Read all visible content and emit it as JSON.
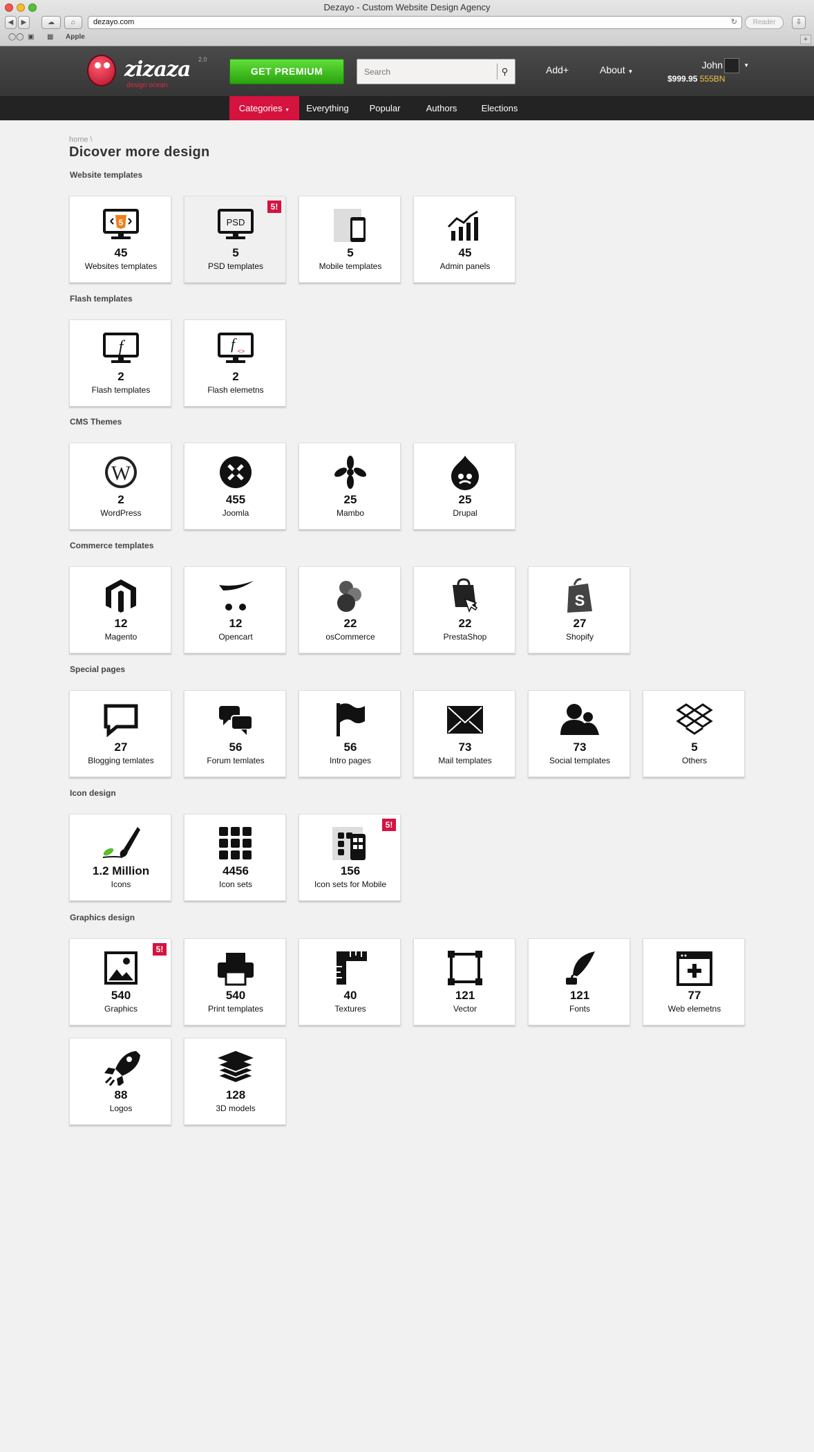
{
  "browser": {
    "title": "Dezayo - Custom Website Design Agency",
    "url": "dezayo.com",
    "reader": "Reader",
    "bookmark": "Apple"
  },
  "header": {
    "logo_word": "zizaza",
    "logo_version": "2.0",
    "logo_tagline": "design ocean",
    "premium": "GET PREMIUM",
    "search_placeholder": "Search",
    "add": "Add+",
    "about": "About",
    "user_name": "John",
    "balance": "$999.95",
    "credits": "555BN"
  },
  "subnav": [
    "Categories",
    "Everything",
    "Popular",
    "Authors",
    "Elections"
  ],
  "breadcrumb": "home \\",
  "page_title": "Dicover more design",
  "badge_text": "5!",
  "sections": [
    {
      "title": "Website templates",
      "tiles": [
        {
          "count": "45",
          "label": "Websites templates",
          "icon": "html5-monitor-icon"
        },
        {
          "count": "5",
          "label": "PSD templates",
          "icon": "psd-monitor-icon"
        },
        {
          "count": "5",
          "label": "Mobile templates",
          "icon": "mobile-icon"
        },
        {
          "count": "45",
          "label": "Admin panels",
          "icon": "chart-icon"
        }
      ]
    },
    {
      "title": "Flash templates",
      "tiles": [
        {
          "count": "2",
          "label": "Flash templates",
          "icon": "flash-monitor-icon"
        },
        {
          "count": "2",
          "label": "Flash elemetns",
          "icon": "flash-code-icon"
        }
      ]
    },
    {
      "title": "CMS Themes",
      "tiles": [
        {
          "count": "2",
          "label": "WordPress",
          "icon": "wordpress-icon"
        },
        {
          "count": "455",
          "label": "Joomla",
          "icon": "joomla-icon"
        },
        {
          "count": "25",
          "label": "Mambo",
          "icon": "mambo-icon"
        },
        {
          "count": "25",
          "label": "Drupal",
          "icon": "drupal-icon"
        }
      ]
    },
    {
      "title": "Commerce templates",
      "tiles": [
        {
          "count": "12",
          "label": "Magento",
          "icon": "magento-icon"
        },
        {
          "count": "12",
          "label": "Opencart",
          "icon": "opencart-icon"
        },
        {
          "count": "22",
          "label": "osCommerce",
          "icon": "oscommerce-icon"
        },
        {
          "count": "22",
          "label": "PrestaShop",
          "icon": "prestashop-icon"
        },
        {
          "count": "27",
          "label": "Shopify",
          "icon": "shopify-icon"
        }
      ]
    },
    {
      "title": "Special pages",
      "tiles": [
        {
          "count": "27",
          "label": "Blogging temlates",
          "icon": "speech-bubble-icon"
        },
        {
          "count": "56",
          "label": "Forum temlates",
          "icon": "chat-bubbles-icon"
        },
        {
          "count": "56",
          "label": "Intro pages",
          "icon": "flag-icon"
        },
        {
          "count": "73",
          "label": "Mail templates",
          "icon": "envelope-icon"
        },
        {
          "count": "73",
          "label": "Social templates",
          "icon": "people-icon"
        },
        {
          "count": "5",
          "label": "Others",
          "icon": "dropbox-icon"
        }
      ]
    },
    {
      "title": "Icon design",
      "tiles": [
        {
          "count": "1.2 Million",
          "label": "Icons",
          "icon": "brush-icon"
        },
        {
          "count": "4456",
          "label": "Icon sets",
          "icon": "grid-icon"
        },
        {
          "count": "156",
          "label": "Icon sets for Mobile",
          "icon": "mobile-grid-icon"
        }
      ]
    },
    {
      "title": "Graphics design",
      "tiles": [
        {
          "count": "540",
          "label": "Graphics",
          "icon": "image-icon"
        },
        {
          "count": "540",
          "label": "Print templates",
          "icon": "printer-icon"
        },
        {
          "count": "40",
          "label": "Textures",
          "icon": "ruler-icon"
        },
        {
          "count": "121",
          "label": "Vector",
          "icon": "vector-icon"
        },
        {
          "count": "121",
          "label": "Fonts",
          "icon": "quill-icon"
        },
        {
          "count": "77",
          "label": "Web elemetns",
          "icon": "web-window-icon"
        },
        {
          "count": "88",
          "label": "Logos",
          "icon": "rocket-icon"
        },
        {
          "count": "128",
          "label": "3D models",
          "icon": "layers-icon"
        }
      ]
    }
  ]
}
